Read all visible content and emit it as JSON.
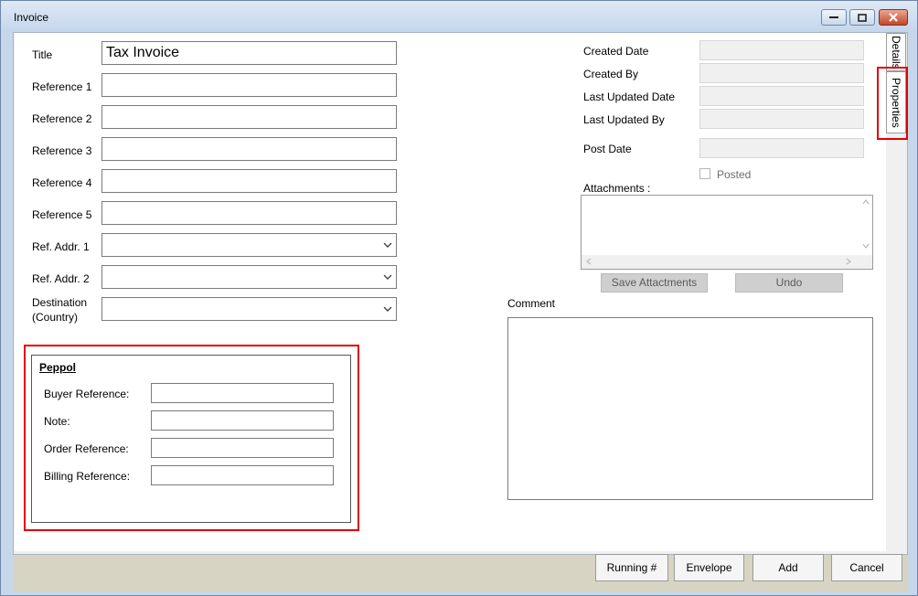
{
  "window": {
    "title": "Invoice"
  },
  "tabs": [
    {
      "label": "Details"
    },
    {
      "label": "Properties"
    }
  ],
  "form": {
    "title_label": "Title",
    "title_value": "Tax Invoice",
    "ref1_label": "Reference 1",
    "ref2_label": "Reference 2",
    "ref3_label": "Reference 3",
    "ref4_label": "Reference 4",
    "ref5_label": "Reference 5",
    "refaddr1_label": "Ref. Addr. 1",
    "refaddr2_label": "Ref. Addr. 2",
    "destination_label_line1": "Destination",
    "destination_label_line2": "(Country)"
  },
  "peppol": {
    "heading": "Peppol",
    "buyer_reference_label": "Buyer Reference:",
    "note_label": "Note:",
    "order_reference_label": "Order Reference:",
    "billing_reference_label": "Billing Reference:"
  },
  "meta": {
    "created_date_label": "Created Date",
    "created_by_label": "Created By",
    "last_updated_date_label": "Last Updated Date",
    "last_updated_by_label": "Last Updated By",
    "post_date_label": "Post Date",
    "posted_label": "Posted",
    "attachments_label": "Attachments :",
    "save_attachments_label": "Save Attactments",
    "undo_label": "Undo",
    "comment_label": "Comment"
  },
  "footer": {
    "running_label": "Running #",
    "envelope_label": "Envelope",
    "add_label": "Add",
    "cancel_label": "Cancel"
  }
}
